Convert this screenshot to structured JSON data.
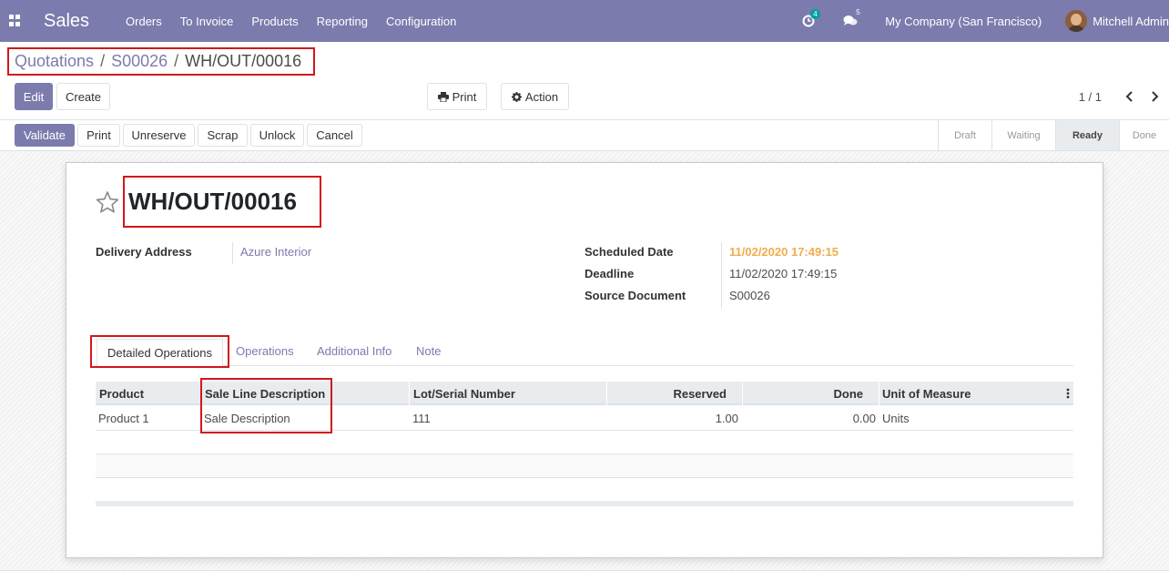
{
  "navbar": {
    "app_name": "Sales",
    "menu": [
      "Orders",
      "To Invoice",
      "Products",
      "Reporting",
      "Configuration"
    ],
    "activity_count": "4",
    "message_count": "5",
    "company": "My Company (San Francisco)",
    "user": "Mitchell Admin"
  },
  "breadcrumb": {
    "items": [
      "Quotations",
      "S00026"
    ],
    "current": "WH/OUT/00016",
    "separator": "/"
  },
  "controls": {
    "edit": "Edit",
    "create": "Create",
    "print": "Print",
    "action": "Action",
    "pager": "1 / 1"
  },
  "statusbar": {
    "buttons": [
      "Validate",
      "Print",
      "Unreserve",
      "Scrap",
      "Unlock",
      "Cancel"
    ],
    "stages": [
      "Draft",
      "Waiting",
      "Ready",
      "Done"
    ],
    "active_stage": "Ready"
  },
  "record": {
    "name": "WH/OUT/00016",
    "delivery_address_label": "Delivery Address",
    "delivery_address": "Azure Interior",
    "scheduled_date_label": "Scheduled Date",
    "scheduled_date": "11/02/2020 17:49:15",
    "deadline_label": "Deadline",
    "deadline": "11/02/2020 17:49:15",
    "source_document_label": "Source Document",
    "source_document": "S00026"
  },
  "tabs": [
    "Detailed Operations",
    "Operations",
    "Additional Info",
    "Note"
  ],
  "table": {
    "headers": [
      "Product",
      "Sale Line Description",
      "Lot/Serial Number",
      "Reserved",
      "Done",
      "Unit of Measure"
    ],
    "rows": [
      [
        "Product 1",
        "Sale Description",
        "111",
        "1.00",
        "0.00",
        "Units"
      ]
    ]
  },
  "colors": {
    "brand": "#7c7bad",
    "highlight": "#d0181c",
    "warning": "#f0ad4e"
  }
}
